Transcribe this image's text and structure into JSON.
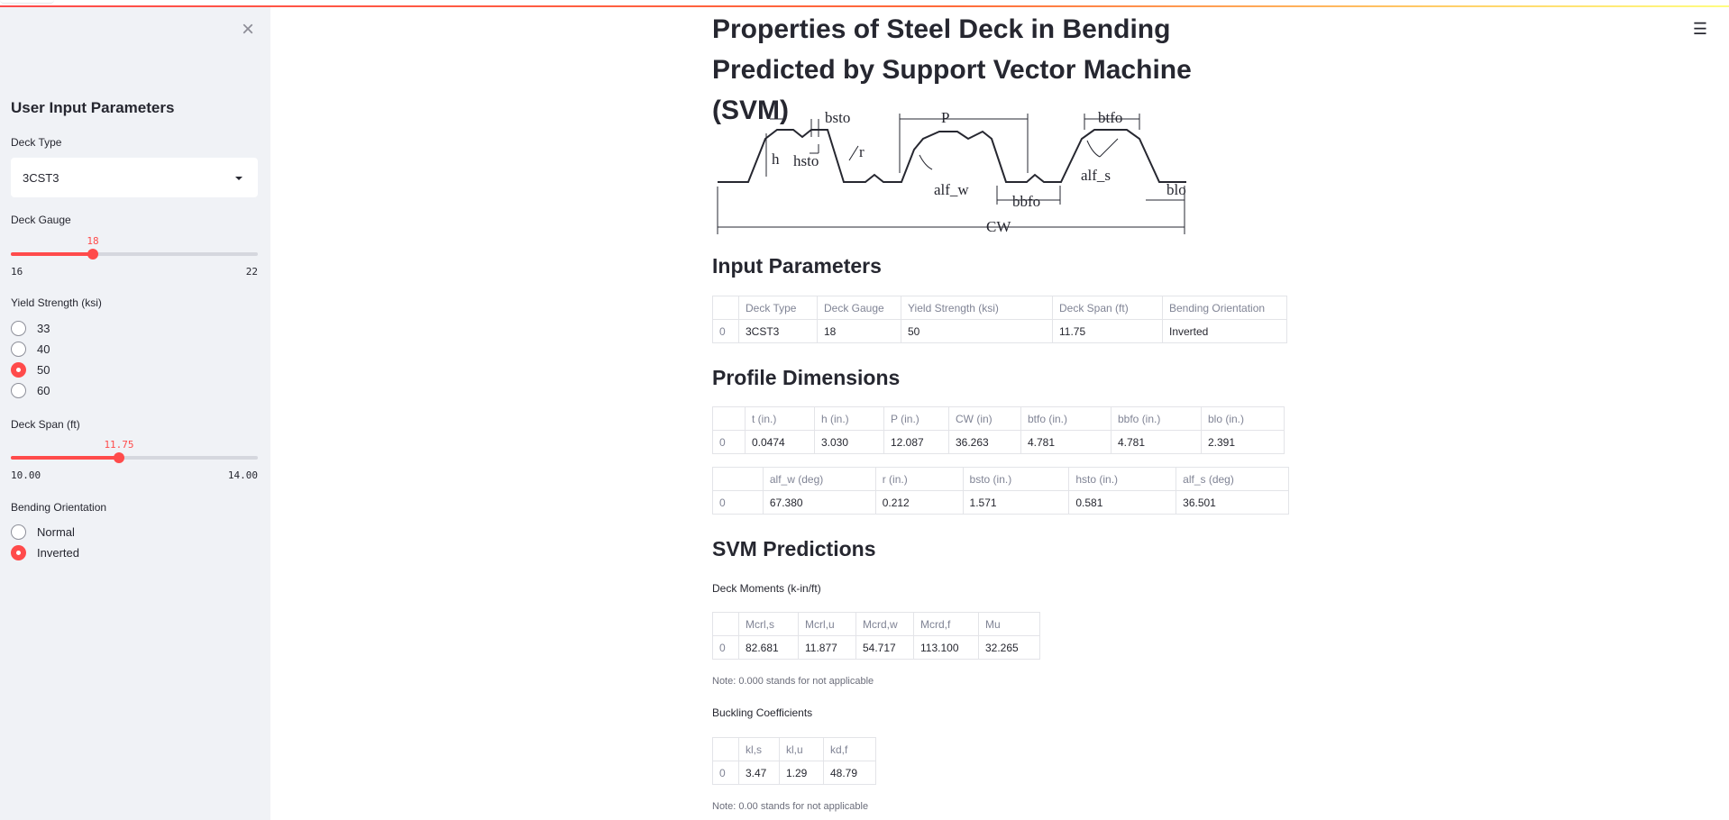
{
  "header": {
    "menu_icon": "hamburger-menu-icon",
    "accent_color": "#ff4b4b"
  },
  "sidebar": {
    "close_icon": "close-icon",
    "title": "User Input Parameters",
    "deck_type": {
      "label": "Deck Type",
      "value": "3CST3"
    },
    "deck_gauge": {
      "label": "Deck Gauge",
      "value": "18",
      "min": "16",
      "max": "22",
      "fraction": 0.333
    },
    "yield_strength": {
      "label": "Yield Strength (ksi)",
      "options": [
        "33",
        "40",
        "50",
        "60"
      ],
      "selected": "50"
    },
    "deck_span": {
      "label": "Deck Span (ft)",
      "value": "11.75",
      "min": "10.00",
      "max": "14.00",
      "fraction": 0.4375
    },
    "bending_orientation": {
      "label": "Bending Orientation",
      "options": [
        "Normal",
        "Inverted"
      ],
      "selected": "Inverted"
    }
  },
  "main": {
    "title": "Properties of Steel Deck in Bending Predicted by Support Vector Machine (SVM)",
    "diagram_labels": {
      "bsto": "bsto",
      "P": "P",
      "btfo": "btfo",
      "r": "r",
      "h": "h",
      "hsto": "hsto",
      "alf_w": "alf_w",
      "alf_s": "alf_s",
      "bbfo": "bbfo",
      "blo": "blo",
      "CW": "CW"
    },
    "input_section": {
      "heading": "Input Parameters",
      "columns": [
        "",
        "Deck Type",
        "Deck Gauge",
        "Yield Strength (ksi)",
        "Deck Span (ft)",
        "Bending Orientation"
      ],
      "row": [
        "0",
        "3CST3",
        "18",
        "50",
        "11.75",
        "Inverted"
      ]
    },
    "profile_section": {
      "heading": "Profile Dimensions",
      "table1": {
        "columns": [
          "",
          "t (in.)",
          "h (in.)",
          "P (in.)",
          "CW (in)",
          "btfo (in.)",
          "bbfo (in.)",
          "blo (in.)"
        ],
        "row": [
          "0",
          "0.0474",
          "3.030",
          "12.087",
          "36.263",
          "4.781",
          "4.781",
          "2.391"
        ]
      },
      "table2": {
        "columns": [
          "",
          "alf_w (deg)",
          "r (in.)",
          "bsto (in.)",
          "hsto (in.)",
          "alf_s (deg)"
        ],
        "row": [
          "0",
          "67.380",
          "0.212",
          "1.571",
          "0.581",
          "36.501"
        ]
      }
    },
    "svm_section": {
      "heading": "SVM Predictions",
      "moments_caption": "Deck Moments (k-in/ft)",
      "moments": {
        "columns": [
          "",
          "Mcrl,s",
          "Mcrl,u",
          "Mcrd,w",
          "Mcrd,f",
          "Mu"
        ],
        "row": [
          "0",
          "82.681",
          "11.877",
          "54.717",
          "113.100",
          "32.265"
        ]
      },
      "moments_note": "Note: 0.000 stands for not applicable",
      "buckling_caption": "Buckling Coefficients",
      "buckling": {
        "columns": [
          "",
          "kl,s",
          "kl,u",
          "kd,f"
        ],
        "row": [
          "0",
          "3.47",
          "1.29",
          "48.79"
        ]
      },
      "buckling_note": "Note: 0.00 stands for not applicable"
    }
  }
}
